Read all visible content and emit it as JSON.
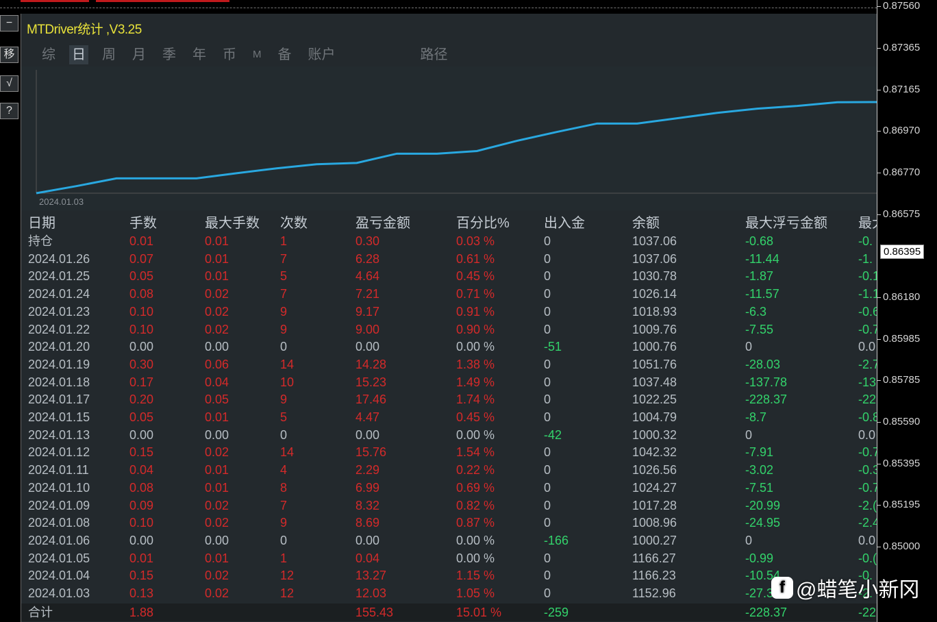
{
  "window": {
    "title": "MTDriver统计 ,V3.25"
  },
  "left_buttons": [
    "−",
    "移",
    "√",
    "?"
  ],
  "tabs": [
    {
      "label": "综"
    },
    {
      "label": "日",
      "active": true
    },
    {
      "label": "周"
    },
    {
      "label": "月"
    },
    {
      "label": "季"
    },
    {
      "label": "年"
    },
    {
      "label": "币"
    },
    {
      "label": "M"
    },
    {
      "label": "备"
    },
    {
      "label": "账户"
    },
    {
      "label": "路径"
    }
  ],
  "chart": {
    "start_label": "2024.01.03",
    "line_color": "#29a8e0"
  },
  "table": {
    "headers": [
      "日期",
      "手数",
      "最大手数",
      "次数",
      "盈亏金额",
      "百分比%",
      "出入金",
      "余额",
      "最大浮亏金额",
      "最大"
    ],
    "rows": [
      [
        "持仓",
        "0.01",
        "0.01",
        "1",
        "0.30",
        "0.03 %",
        "0",
        "1037.06",
        "-0.68",
        "-0."
      ],
      [
        "2024.01.26",
        "0.07",
        "0.01",
        "7",
        "6.28",
        "0.61 %",
        "0",
        "1037.06",
        "-11.44",
        "-1."
      ],
      [
        "2024.01.25",
        "0.05",
        "0.01",
        "5",
        "4.64",
        "0.45 %",
        "0",
        "1030.78",
        "-1.87",
        "-0.1"
      ],
      [
        "2024.01.24",
        "0.08",
        "0.02",
        "7",
        "7.21",
        "0.71 %",
        "0",
        "1026.14",
        "-11.57",
        "-1.1"
      ],
      [
        "2024.01.23",
        "0.10",
        "0.02",
        "9",
        "9.17",
        "0.91 %",
        "0",
        "1018.93",
        "-6.3",
        "-0.6"
      ],
      [
        "2024.01.22",
        "0.10",
        "0.02",
        "9",
        "9.00",
        "0.90 %",
        "0",
        "1009.76",
        "-7.55",
        "-0.7"
      ],
      [
        "2024.01.20",
        "0.00",
        "0.00",
        "0",
        "0.00",
        "0.00 %",
        "-51",
        "1000.76",
        "0",
        "0.0"
      ],
      [
        "2024.01.19",
        "0.30",
        "0.06",
        "14",
        "14.28",
        "1.38 %",
        "0",
        "1051.76",
        "-28.03",
        "-2.7"
      ],
      [
        "2024.01.18",
        "0.17",
        "0.04",
        "10",
        "15.23",
        "1.49 %",
        "0",
        "1037.48",
        "-137.78",
        "-13"
      ],
      [
        "2024.01.17",
        "0.20",
        "0.05",
        "9",
        "17.46",
        "1.74 %",
        "0",
        "1022.25",
        "-228.37",
        "-22"
      ],
      [
        "2024.01.15",
        "0.05",
        "0.01",
        "5",
        "4.47",
        "0.45 %",
        "0",
        "1004.79",
        "-8.7",
        "-0.8"
      ],
      [
        "2024.01.13",
        "0.00",
        "0.00",
        "0",
        "0.00",
        "0.00 %",
        "-42",
        "1000.32",
        "0",
        "0.0"
      ],
      [
        "2024.01.12",
        "0.15",
        "0.02",
        "14",
        "15.76",
        "1.54 %",
        "0",
        "1042.32",
        "-7.91",
        "-0.7"
      ],
      [
        "2024.01.11",
        "0.04",
        "0.01",
        "4",
        "2.29",
        "0.22 %",
        "0",
        "1026.56",
        "-3.02",
        "-0.3"
      ],
      [
        "2024.01.10",
        "0.08",
        "0.01",
        "8",
        "6.99",
        "0.69 %",
        "0",
        "1024.27",
        "-7.51",
        "-0.7"
      ],
      [
        "2024.01.09",
        "0.09",
        "0.02",
        "7",
        "8.32",
        "0.82 %",
        "0",
        "1017.28",
        "-20.99",
        "-2.("
      ],
      [
        "2024.01.08",
        "0.10",
        "0.02",
        "9",
        "8.69",
        "0.87 %",
        "0",
        "1008.96",
        "-24.95",
        "-2.4"
      ],
      [
        "2024.01.06",
        "0.00",
        "0.00",
        "0",
        "0.00",
        "0.00 %",
        "-166",
        "1000.27",
        "0",
        "0.0"
      ],
      [
        "2024.01.05",
        "0.01",
        "0.01",
        "1",
        "0.04",
        "0.00 %",
        "0",
        "1166.27",
        "-0.99",
        "-0.("
      ],
      [
        "2024.01.04",
        "0.15",
        "0.02",
        "12",
        "13.27",
        "1.15 %",
        "0",
        "1166.23",
        "-10.54",
        "-0."
      ],
      [
        "2024.01.03",
        "0.13",
        "0.02",
        "12",
        "12.03",
        "1.05 %",
        "0",
        "1152.96",
        "-27.3",
        "-2."
      ]
    ],
    "total": [
      "合计",
      "1.88",
      "",
      "",
      "155.43",
      "15.01 %",
      "-259",
      "",
      "-228.37",
      "-22"
    ]
  },
  "price_axis": {
    "ticks": [
      "0.87560",
      "0.87365",
      "0.87165",
      "0.86970",
      "0.86770",
      "0.86575",
      "0.86180",
      "0.85985",
      "0.85785",
      "0.85590",
      "0.85395",
      "0.85195",
      "0.85000"
    ],
    "current": "0.86395"
  },
  "watermark": "@蜡笔小新冈",
  "colors": {
    "title": "#e8e23a",
    "profit": "#d42a2a",
    "loss": "#33d36b",
    "panel": "#23292d"
  }
}
